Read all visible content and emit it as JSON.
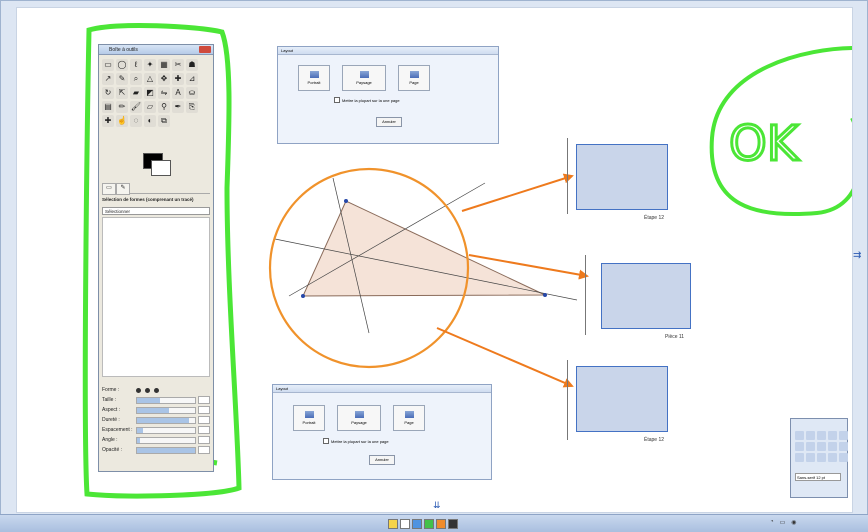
{
  "toolbox": {
    "title": "Boîte à outils",
    "heading": "Sélection de formes (comprenant un tracé)",
    "field_value": "Sélectionner",
    "options": [
      {
        "label": "Forme :"
      },
      {
        "label": "Taille :"
      },
      {
        "label": "Aspect :"
      },
      {
        "label": "Dureté :"
      },
      {
        "label": "Espacement :"
      },
      {
        "label": "Angle :"
      },
      {
        "label": "Opacité :"
      }
    ]
  },
  "dialog_top": {
    "title": "Layout",
    "buttons": [
      "Portrait",
      "Paysage",
      "Page"
    ],
    "checkbox": "Mettre la plupart sur la une page",
    "ok": "Annuler"
  },
  "dialog_bottom": {
    "title": "Layout",
    "buttons": [
      "Portrait",
      "Paysage",
      "Page"
    ],
    "checkbox": "Mettre la plupart sur la une page",
    "ok": "Annuler"
  },
  "thumbs": [
    {
      "label": "Étape 12",
      "num": "1"
    },
    {
      "label": "Pièce 11",
      "num": "1"
    },
    {
      "label": "Étape 12",
      "num": "1"
    }
  ],
  "annotation": "OK",
  "floatbar": {
    "select": "Sans-serif 12 pt"
  },
  "colors": {
    "highlight": "#4be636",
    "circle": "#f0922b",
    "arrow": "#ee7a1d",
    "triangle": "#f5e3d8"
  }
}
